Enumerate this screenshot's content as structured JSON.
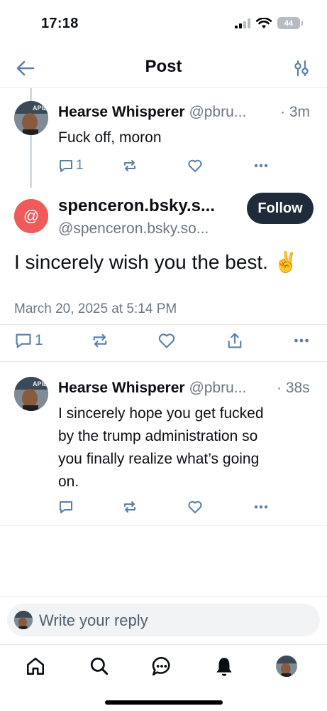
{
  "status_bar": {
    "time": "17:18",
    "battery": "44"
  },
  "header": {
    "title": "Post"
  },
  "reply_top": {
    "display_name": "Hearse Whisperer",
    "handle": "@pbru...",
    "time": "· 3m",
    "text": "Fuck off, moron",
    "reply_count": "1",
    "avatar_badge": "APID"
  },
  "main_post": {
    "display_name": "spenceron.bsky.s...",
    "handle": "@spenceron.bsky.so...",
    "follow_label": "Follow",
    "avatar_symbol": "@",
    "text": "I sincerely wish you the best. ✌️",
    "date": "March 20, 2025 at 5:14 PM",
    "reply_count": "1"
  },
  "reply_bottom": {
    "display_name": "Hearse Whisperer",
    "handle": "@pbru...",
    "time": "· 38s",
    "text_lines": [
      "I sincerely hope you get fucked",
      "by the trump administration so",
      "you finally realize what’s going",
      "on."
    ],
    "avatar_badge": "APID"
  },
  "composer": {
    "placeholder": "Write your reply"
  },
  "colors": {
    "accent": "#5b7fa8",
    "follow_bg": "#1f2b3a",
    "mention_avatar": "#f05a5a"
  },
  "icons": [
    "back-arrow-icon",
    "filter-settings-icon",
    "reply-icon",
    "repost-icon",
    "like-icon",
    "more-icon",
    "share-icon",
    "home-icon",
    "search-icon",
    "chat-icon",
    "bell-icon"
  ]
}
